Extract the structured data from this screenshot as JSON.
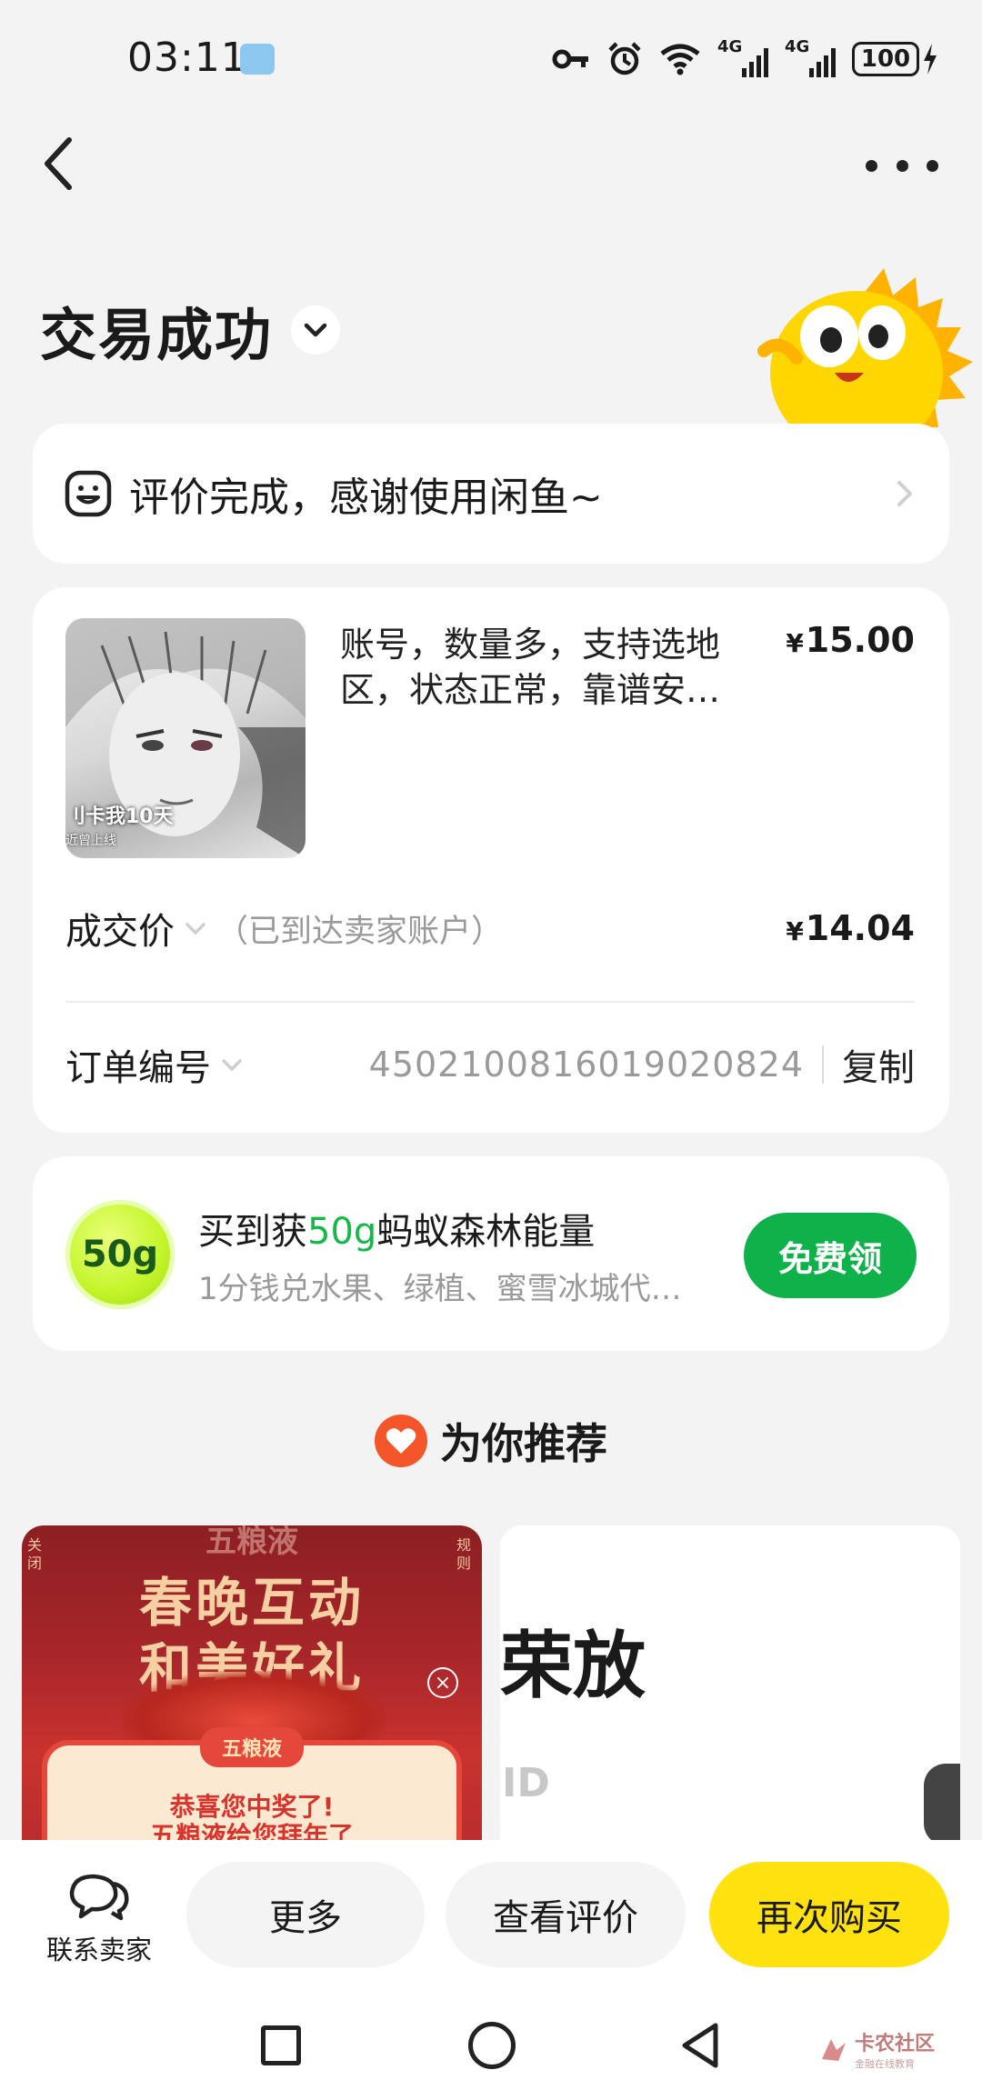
{
  "status_bar": {
    "time": "03:11",
    "net1": "4G",
    "net2": "4G",
    "battery": "100"
  },
  "header": {
    "title": "交易成功"
  },
  "review_banner": {
    "text": "评价完成，感谢使用闲鱼~"
  },
  "order": {
    "thumb_caption_1": "刂卡我10天",
    "thumb_caption_2": "近曾上线",
    "product_title": "账号，数量多，支持选地区，状态正常，靠谱安…",
    "currency": "¥",
    "product_price": "15.00",
    "deal_label": "成交价",
    "deal_note": "（已到达卖家账户）",
    "deal_price": "14.04",
    "order_no_label": "订单编号",
    "order_no": "4502100816019020824",
    "copy_label": "复制"
  },
  "energy": {
    "badge": "50g",
    "title_pre": "买到获",
    "title_hl": "50g",
    "title_post": "蚂蚁森林能量",
    "subtitle": "1分钱兑水果、绿植、蜜雪冰城代…",
    "button": "免费领",
    "accent": "#17b84a"
  },
  "recommend": {
    "title": "为你推荐",
    "left_card": {
      "tag_left": "关闭",
      "tag_right": "规则",
      "line1": "春晚互动",
      "line2": "和美好礼",
      "brand": "五粮液",
      "win_line1": "恭喜您中奖了!",
      "win_line2": "五粮液给您拜年了"
    },
    "right_card": {
      "big_text": "荣放",
      "sub_text": "ID"
    }
  },
  "action_bar": {
    "contact_label": "联系卖家",
    "more_label": "更多",
    "review_label": "查看评价",
    "rebuy_label": "再次购买",
    "rebuy_color": "#ffe20f"
  },
  "watermark": {
    "main": "卡农社区",
    "sub": "金融在线教育"
  }
}
